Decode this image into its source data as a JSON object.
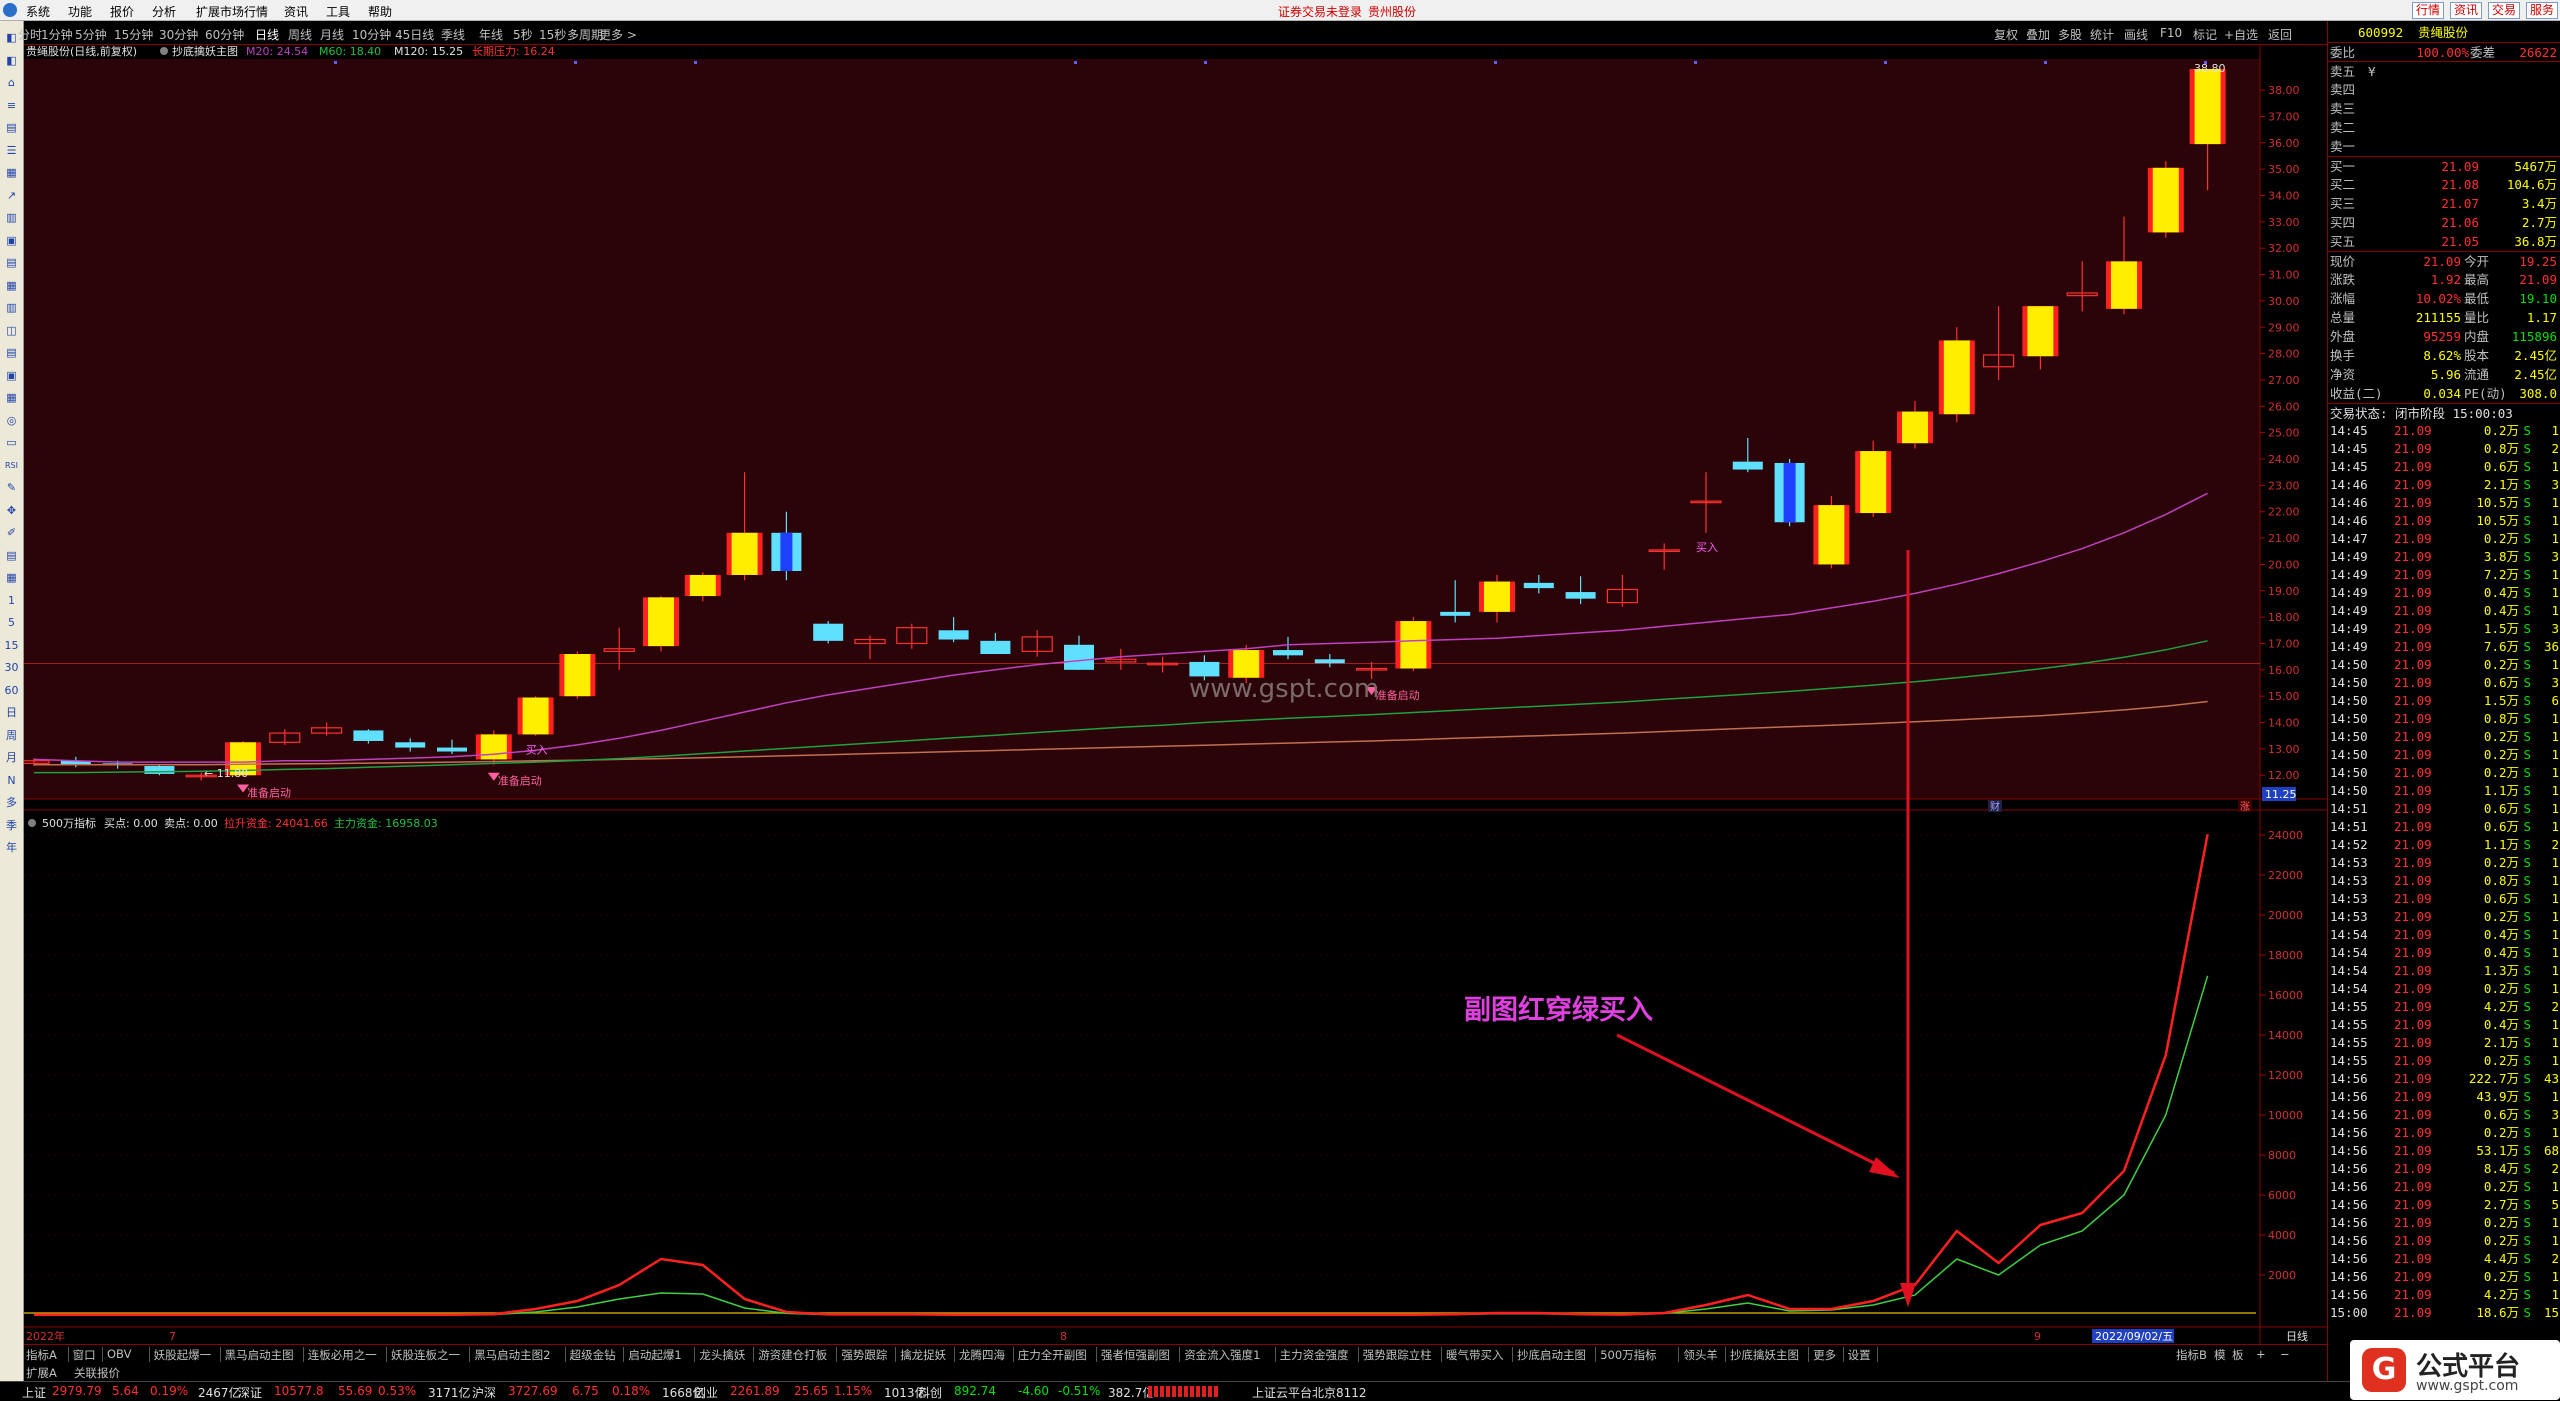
{
  "menubar": {
    "items": [
      "系统",
      "功能",
      "报价",
      "分析",
      "扩展市场行情",
      "资讯",
      "工具",
      "帮助"
    ],
    "notice": "证券交易未登录",
    "stock_name": "贵州股份",
    "right_buttons": [
      "行情",
      "资讯",
      "交易",
      "服务"
    ]
  },
  "period_bar": {
    "items": [
      "分时",
      "1分钟",
      "5分钟",
      "15分钟",
      "30分钟",
      "60分钟",
      "日线",
      "周线",
      "月线",
      "10分钟",
      "45日线",
      "季线",
      "年线",
      "5秒",
      "15秒",
      "多周期",
      "更多 >"
    ],
    "active_index": 6,
    "right_items": [
      "复权",
      "叠加",
      "多股",
      "统计",
      "画线",
      "F10",
      "标记",
      "+自选",
      "返回"
    ]
  },
  "chart_header": {
    "stock_title": "贵绳股份(日线,前复权)",
    "indicator_name": "抄底擒妖主图",
    "ma20_label": "M20: 24.54",
    "ma60_label": "M60: 18.40",
    "ma120_label": "M120: 15.25",
    "pressure_label": "长期压力: 16.24",
    "top_price_label": "38.80",
    "low_price_label": "← 11.80",
    "current_price_tag": "11.25"
  },
  "sub_header": {
    "name": "500万指标",
    "buy_label": "买点: 0.00",
    "sell_label": "卖点: 0.00",
    "pull_label": "拉升资金: 24041.66",
    "main_label": "主力资金: 16958.03"
  },
  "annotations": {
    "watermark": "www.gspt.com",
    "red_green_text": "副图红穿绿买入",
    "ready_start": "准备启动",
    "buy": "买入"
  },
  "x_axis": {
    "left": "2022年",
    "m7": "7",
    "m8": "8",
    "m9": "9",
    "date_tag": "2022/09/02/五",
    "right_label": "日线",
    "marker_cai": "财",
    "marker_zhang": "涨"
  },
  "main_axis": {
    "ticks": [
      "38.00",
      "37.00",
      "36.00",
      "35.00",
      "34.00",
      "33.00",
      "32.00",
      "31.00",
      "30.00",
      "29.00",
      "28.00",
      "27.00",
      "26.00",
      "25.00",
      "24.00",
      "23.00",
      "22.00",
      "21.00",
      "20.00",
      "19.00",
      "18.00",
      "17.00",
      "16.00",
      "15.00",
      "14.00",
      "13.00",
      "12.00"
    ]
  },
  "sub_axis": {
    "ticks": [
      "24000",
      "22000",
      "20000",
      "18000",
      "16000",
      "14000",
      "12000",
      "10000",
      "8000",
      "6000",
      "4000",
      "2000"
    ]
  },
  "chart_data": {
    "type": "candlestick",
    "ma_colors": {
      "ma20": "#c040c0",
      "ma60": "#20a040",
      "ma120": "#c07050"
    },
    "up_color": "#ffee00",
    "down_color": "#60e0ff",
    "pull_fund_color": "#ff2020",
    "main_fund_color": "#40d040",
    "ylim_main": [
      11.25,
      38.8
    ],
    "ylim_sub": [
      0,
      24500
    ],
    "candles": [
      [
        12.45,
        12.65,
        12.35,
        12.55
      ],
      [
        12.55,
        12.7,
        12.3,
        12.4
      ],
      [
        12.45,
        12.55,
        12.25,
        12.4
      ],
      [
        12.35,
        12.4,
        12.0,
        12.05
      ],
      [
        11.95,
        12.1,
        11.8,
        12.0
      ],
      [
        12.0,
        13.3,
        11.95,
        13.25
      ],
      [
        13.25,
        13.75,
        13.15,
        13.6
      ],
      [
        13.6,
        14.0,
        13.5,
        13.8
      ],
      [
        13.7,
        13.75,
        13.2,
        13.3
      ],
      [
        13.25,
        13.4,
        12.9,
        13.05
      ],
      [
        13.05,
        13.35,
        12.8,
        12.9
      ],
      [
        12.6,
        13.7,
        12.4,
        13.55
      ],
      [
        13.55,
        15.0,
        13.5,
        14.95
      ],
      [
        15.0,
        16.7,
        14.9,
        16.6
      ],
      [
        16.7,
        17.6,
        16.0,
        16.8
      ],
      [
        16.9,
        18.8,
        16.7,
        18.75
      ],
      [
        18.8,
        19.7,
        18.6,
        19.6
      ],
      [
        19.6,
        23.5,
        19.4,
        21.2
      ],
      [
        21.2,
        22.0,
        19.4,
        19.75
      ],
      [
        17.75,
        17.85,
        17.0,
        17.1
      ],
      [
        17.0,
        17.3,
        16.4,
        17.15
      ],
      [
        17.0,
        17.75,
        16.8,
        17.6
      ],
      [
        17.5,
        18.0,
        17.05,
        17.15
      ],
      [
        17.1,
        17.4,
        16.6,
        16.6
      ],
      [
        16.7,
        17.5,
        16.5,
        17.25
      ],
      [
        16.95,
        17.3,
        16.0,
        16.0
      ],
      [
        16.3,
        16.8,
        16.0,
        16.4
      ],
      [
        16.2,
        16.5,
        15.9,
        16.25
      ],
      [
        16.3,
        16.55,
        15.6,
        15.75
      ],
      [
        15.7,
        16.95,
        15.5,
        16.75
      ],
      [
        16.75,
        17.25,
        16.4,
        16.55
      ],
      [
        16.4,
        16.6,
        16.1,
        16.25
      ],
      [
        16.0,
        16.3,
        15.65,
        16.05
      ],
      [
        16.05,
        18.0,
        15.95,
        17.85
      ],
      [
        18.2,
        19.4,
        17.8,
        18.05
      ],
      [
        18.2,
        19.6,
        17.8,
        19.35
      ],
      [
        19.3,
        19.6,
        18.9,
        19.1
      ],
      [
        18.95,
        19.55,
        18.5,
        18.7
      ],
      [
        18.55,
        19.6,
        18.4,
        19.05
      ],
      [
        20.55,
        20.8,
        19.8,
        20.55
      ],
      [
        22.4,
        23.5,
        21.2,
        22.4
      ],
      [
        23.9,
        24.8,
        23.5,
        23.6
      ],
      [
        23.85,
        24.0,
        21.45,
        21.6
      ],
      [
        20.0,
        22.6,
        19.85,
        22.25
      ],
      [
        21.95,
        24.7,
        21.8,
        24.3
      ],
      [
        24.6,
        26.2,
        24.4,
        25.8
      ],
      [
        25.7,
        29.0,
        25.4,
        28.5
      ],
      [
        27.5,
        29.8,
        27.0,
        27.95
      ],
      [
        27.9,
        29.8,
        27.4,
        29.8
      ],
      [
        30.2,
        31.5,
        29.6,
        30.3
      ],
      [
        29.7,
        33.2,
        29.5,
        31.5
      ],
      [
        32.6,
        35.3,
        32.4,
        35.05
      ],
      [
        35.95,
        38.8,
        34.2,
        38.8
      ]
    ],
    "ma20": [
      12.6,
      12.55,
      12.5,
      12.5,
      12.5,
      12.5,
      12.55,
      12.55,
      12.6,
      12.65,
      12.7,
      12.8,
      12.95,
      13.15,
      13.4,
      13.7,
      14.05,
      14.4,
      14.75,
      15.05,
      15.3,
      15.55,
      15.8,
      16.0,
      16.2,
      16.35,
      16.5,
      16.6,
      16.7,
      16.8,
      16.95,
      17.0,
      17.05,
      17.1,
      17.15,
      17.2,
      17.3,
      17.4,
      17.5,
      17.65,
      17.8,
      17.95,
      18.1,
      18.35,
      18.6,
      18.9,
      19.25,
      19.65,
      20.1,
      20.6,
      21.2,
      21.9,
      22.7
    ],
    "ma60": [
      12.1,
      12.1,
      12.12,
      12.13,
      12.15,
      12.18,
      12.22,
      12.25,
      12.3,
      12.35,
      12.4,
      12.45,
      12.5,
      12.56,
      12.63,
      12.72,
      12.82,
      12.92,
      13.02,
      13.12,
      13.22,
      13.32,
      13.42,
      13.52,
      13.62,
      13.72,
      13.82,
      13.9,
      14.0,
      14.08,
      14.16,
      14.23,
      14.3,
      14.38,
      14.46,
      14.54,
      14.62,
      14.7,
      14.78,
      14.88,
      14.98,
      15.08,
      15.18,
      15.3,
      15.42,
      15.55,
      15.7,
      15.86,
      16.04,
      16.24,
      16.48,
      16.76,
      17.1
    ],
    "ma120": [
      12.4,
      12.4,
      12.4,
      12.4,
      12.4,
      12.42,
      12.43,
      12.44,
      12.46,
      12.48,
      12.5,
      12.52,
      12.55,
      12.57,
      12.6,
      12.63,
      12.66,
      12.7,
      12.74,
      12.78,
      12.82,
      12.86,
      12.9,
      12.94,
      12.98,
      13.02,
      13.06,
      13.1,
      13.14,
      13.18,
      13.22,
      13.26,
      13.3,
      13.35,
      13.4,
      13.45,
      13.5,
      13.55,
      13.6,
      13.66,
      13.72,
      13.78,
      13.84,
      13.9,
      13.96,
      14.03,
      14.1,
      14.18,
      14.26,
      14.36,
      14.48,
      14.62,
      14.8
    ],
    "pull_fund": [
      10,
      10,
      10,
      10,
      10,
      10,
      10,
      10,
      10,
      10,
      10,
      40,
      300,
      700,
      1500,
      2800,
      2500,
      800,
      150,
      30,
      30,
      30,
      10,
      10,
      10,
      10,
      10,
      10,
      10,
      10,
      10,
      10,
      10,
      10,
      40,
      100,
      100,
      40,
      20,
      100,
      500,
      1000,
      300,
      300,
      700,
      1500,
      4200,
      2600,
      4500,
      5100,
      7200,
      13000,
      24041.66
    ],
    "main_fund": [
      10,
      10,
      10,
      10,
      10,
      10,
      10,
      10,
      10,
      10,
      10,
      20,
      150,
      400,
      800,
      1100,
      1050,
      350,
      80,
      20,
      20,
      20,
      10,
      10,
      10,
      10,
      10,
      10,
      10,
      10,
      10,
      10,
      10,
      10,
      30,
      60,
      60,
      30,
      20,
      80,
      300,
      600,
      200,
      250,
      500,
      1000,
      2800,
      2000,
      3500,
      4200,
      6000,
      10000,
      16958.03
    ]
  },
  "right_panel": {
    "code": "600992",
    "name": "贵绳股份",
    "weibi_label": "委比",
    "weibi": "100.00%",
    "weicha_label": "委差",
    "weicha": "26622",
    "sells": [
      {
        "label": "卖五",
        "price": "¥",
        "vol": ""
      },
      {
        "label": "卖四",
        "price": "",
        "vol": ""
      },
      {
        "label": "卖三",
        "price": "",
        "vol": ""
      },
      {
        "label": "卖二",
        "price": "",
        "vol": ""
      },
      {
        "label": "卖一",
        "price": "",
        "vol": ""
      }
    ],
    "buys": [
      {
        "label": "买一",
        "price": "21.09",
        "vol": "5467万"
      },
      {
        "label": "买二",
        "price": "21.08",
        "vol": "104.6万"
      },
      {
        "label": "买三",
        "price": "21.07",
        "vol": "3.4万"
      },
      {
        "label": "买四",
        "price": "21.06",
        "vol": "2.7万"
      },
      {
        "label": "买五",
        "price": "21.05",
        "vol": "36.8万"
      }
    ],
    "stats": [
      {
        "l1": "现价",
        "v1": "21.09",
        "l2": "今开",
        "v2": "19.25"
      },
      {
        "l1": "涨跌",
        "v1": "1.92",
        "l2": "最高",
        "v2": "21.09"
      },
      {
        "l1": "涨幅",
        "v1": "10.02%",
        "l2": "最低",
        "v2": "19.10"
      },
      {
        "l1": "总量",
        "v1": "211155",
        "l2": "量比",
        "v2": "1.17"
      },
      {
        "l1": "外盘",
        "v1": "95259",
        "l2": "内盘",
        "v2": "115896"
      },
      {
        "l1": "换手",
        "v1": "8.62%",
        "l2": "股本",
        "v2": "2.45亿"
      },
      {
        "l1": "净资",
        "v1": "5.96",
        "l2": "流通",
        "v2": "2.45亿"
      },
      {
        "l1": "收益(二)",
        "v1": "0.034",
        "l2": "PE(动)",
        "v2": "308.0"
      }
    ],
    "trade_status": "交易状态: 闭市阶段 15:00:03",
    "ticks": [
      [
        "14:45",
        "21.09",
        "0.2万",
        "S",
        "1"
      ],
      [
        "14:45",
        "21.09",
        "0.8万",
        "S",
        "2"
      ],
      [
        "14:45",
        "21.09",
        "0.6万",
        "S",
        "1"
      ],
      [
        "14:46",
        "21.09",
        "2.1万",
        "S",
        "3"
      ],
      [
        "14:46",
        "21.09",
        "10.5万",
        "S",
        "1"
      ],
      [
        "14:46",
        "21.09",
        "10.5万",
        "S",
        "1"
      ],
      [
        "14:47",
        "21.09",
        "0.2万",
        "S",
        "1"
      ],
      [
        "14:49",
        "21.09",
        "3.8万",
        "S",
        "3"
      ],
      [
        "14:49",
        "21.09",
        "7.2万",
        "S",
        "1"
      ],
      [
        "14:49",
        "21.09",
        "0.4万",
        "S",
        "1"
      ],
      [
        "14:49",
        "21.09",
        "0.4万",
        "S",
        "1"
      ],
      [
        "14:49",
        "21.09",
        "1.5万",
        "S",
        "3"
      ],
      [
        "14:49",
        "21.09",
        "7.6万",
        "S",
        "36"
      ],
      [
        "14:50",
        "21.09",
        "0.2万",
        "S",
        "1"
      ],
      [
        "14:50",
        "21.09",
        "0.6万",
        "S",
        "3"
      ],
      [
        "14:50",
        "21.09",
        "1.5万",
        "S",
        "6"
      ],
      [
        "14:50",
        "21.09",
        "0.8万",
        "S",
        "1"
      ],
      [
        "14:50",
        "21.09",
        "0.2万",
        "S",
        "1"
      ],
      [
        "14:50",
        "21.09",
        "0.2万",
        "S",
        "1"
      ],
      [
        "14:50",
        "21.09",
        "0.2万",
        "S",
        "1"
      ],
      [
        "14:50",
        "21.09",
        "1.1万",
        "S",
        "1"
      ],
      [
        "14:51",
        "21.09",
        "0.6万",
        "S",
        "1"
      ],
      [
        "14:51",
        "21.09",
        "0.6万",
        "S",
        "1"
      ],
      [
        "14:52",
        "21.09",
        "1.1万",
        "S",
        "2"
      ],
      [
        "14:53",
        "21.09",
        "0.2万",
        "S",
        "1"
      ],
      [
        "14:53",
        "21.09",
        "0.8万",
        "S",
        "1"
      ],
      [
        "14:53",
        "21.09",
        "0.6万",
        "S",
        "1"
      ],
      [
        "14:53",
        "21.09",
        "0.2万",
        "S",
        "1"
      ],
      [
        "14:54",
        "21.09",
        "0.4万",
        "S",
        "1"
      ],
      [
        "14:54",
        "21.09",
        "0.4万",
        "S",
        "1"
      ],
      [
        "14:54",
        "21.09",
        "1.3万",
        "S",
        "1"
      ],
      [
        "14:54",
        "21.09",
        "0.2万",
        "S",
        "1"
      ],
      [
        "14:55",
        "21.09",
        "4.2万",
        "S",
        "2"
      ],
      [
        "14:55",
        "21.09",
        "0.4万",
        "S",
        "1"
      ],
      [
        "14:55",
        "21.09",
        "2.1万",
        "S",
        "1"
      ],
      [
        "14:55",
        "21.09",
        "0.2万",
        "S",
        "1"
      ],
      [
        "14:56",
        "21.09",
        "222.7万",
        "S",
        "43"
      ],
      [
        "14:56",
        "21.09",
        "43.9万",
        "S",
        "1"
      ],
      [
        "14:56",
        "21.09",
        "0.6万",
        "S",
        "3"
      ],
      [
        "14:56",
        "21.09",
        "0.2万",
        "S",
        "1"
      ],
      [
        "14:56",
        "21.09",
        "53.1万",
        "S",
        "68"
      ],
      [
        "14:56",
        "21.09",
        "8.4万",
        "S",
        "2"
      ],
      [
        "14:56",
        "21.09",
        "0.2万",
        "S",
        "1"
      ],
      [
        "14:56",
        "21.09",
        "2.7万",
        "S",
        "5"
      ],
      [
        "14:56",
        "21.09",
        "0.2万",
        "S",
        "1"
      ],
      [
        "14:56",
        "21.09",
        "0.2万",
        "S",
        "1"
      ],
      [
        "14:56",
        "21.09",
        "4.4万",
        "S",
        "2"
      ],
      [
        "14:56",
        "21.09",
        "0.2万",
        "S",
        "1"
      ],
      [
        "14:56",
        "21.09",
        "4.2万",
        "S",
        "1"
      ],
      [
        "15:00",
        "21.09",
        "18.6万",
        "S",
        "15"
      ]
    ],
    "footer": "笔"
  },
  "bottom_tabs": [
    "指标A",
    "窗口",
    "OBV",
    "妖股起爆一",
    "黑马启动主图",
    "连板必用之一",
    "妖股连板之一",
    "黑马启动主图2",
    "超级金钻",
    "启动起爆1",
    "龙头擒妖",
    "游资建仓打板",
    "强势跟踪",
    "擒龙捉妖",
    "龙腾四海",
    "庄力全开副图",
    "强者恒强副图",
    "资金流入强度1",
    "主力资金强度",
    "强势跟踪立柱",
    "暖气带买入",
    "抄底启动主图",
    "500万指标",
    "领头羊",
    "抄底擒妖主图",
    "更多",
    "设置"
  ],
  "bottom_right": [
    "指标B",
    "模",
    "板",
    "+",
    "−"
  ],
  "sub_tabs": [
    "扩展A",
    "关联报价"
  ],
  "status_bar": {
    "items": [
      {
        "name": "上证",
        "v1": "2979.79",
        "v2": "5.64",
        "v3": "0.19%",
        "v4": "2467亿"
      },
      {
        "name": "深证",
        "v1": "10577.8",
        "v2": "55.69",
        "v3": "0.53%",
        "v4": "3171亿"
      },
      {
        "name": "沪深",
        "v1": "3727.69",
        "v2": "6.75",
        "v3": "0.18%",
        "v4": "1668亿"
      },
      {
        "name": "创业",
        "v1": "2261.89",
        "v2": "25.65",
        "v3": "1.15%",
        "v4": "1013亿"
      },
      {
        "name": "科创",
        "v1": "892.74",
        "v2": "-4.60",
        "v3": "-0.51%",
        "v4": "382.7亿"
      }
    ],
    "server": "上证云平台北京8112"
  },
  "logo": {
    "title": "公式平台",
    "url": "www.gspt.com"
  }
}
